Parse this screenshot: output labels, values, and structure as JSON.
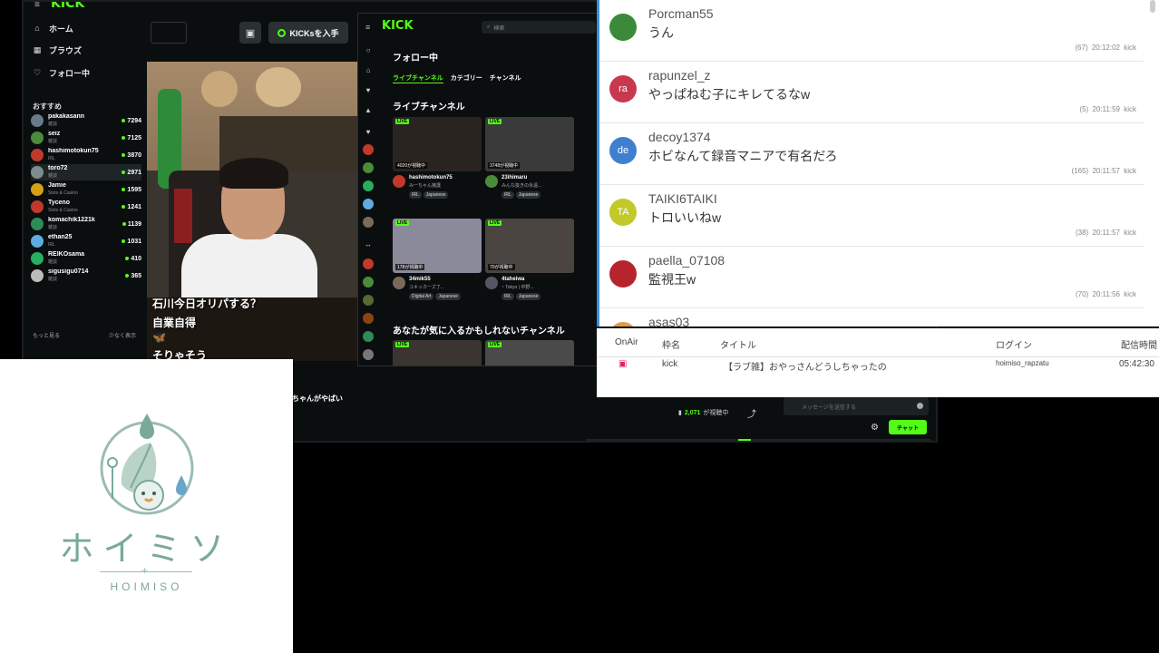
{
  "kick_main": {
    "logo": "KICK",
    "nav": [
      {
        "icon": "home-icon",
        "glyph": "⌂",
        "label": "ホーム"
      },
      {
        "icon": "browse-icon",
        "glyph": "▦",
        "label": "ブラウズ"
      },
      {
        "icon": "heart-icon",
        "glyph": "♡",
        "label": "フォロー中"
      }
    ],
    "recommended_heading": "おすすめ",
    "channels": [
      {
        "name": "pakakasann",
        "category": "雑談",
        "viewers": "7294",
        "color": "#6b7a8a"
      },
      {
        "name": "seiz",
        "category": "雑談",
        "viewers": "7125",
        "color": "#4b8b3b"
      },
      {
        "name": "hashimotokun75",
        "category": "IRL",
        "viewers": "3870",
        "color": "#c0392b"
      },
      {
        "name": "toro72",
        "category": "雑談",
        "viewers": "2971",
        "color": "#7f8c8d"
      },
      {
        "name": "Jamie",
        "category": "Slots & Casino",
        "viewers": "1595",
        "color": "#d4a017"
      },
      {
        "name": "Tyceno",
        "category": "Slots & Casino",
        "viewers": "1241",
        "color": "#c0392b"
      },
      {
        "name": "komachik1221k",
        "category": "雑談",
        "viewers": "1139",
        "color": "#2e8b57"
      },
      {
        "name": "ethan25",
        "category": "IRL",
        "viewers": "1031",
        "color": "#5dade2"
      },
      {
        "name": "REIKOsama",
        "category": "雑談",
        "viewers": "410",
        "color": "#27ae60"
      },
      {
        "name": "sigusigu0714",
        "category": "雑談",
        "viewers": "365",
        "color": "#bbb"
      }
    ],
    "show_more": "もっと見る",
    "show_less": "少なく表示",
    "kicks_button": "KICKsを入手",
    "overlay_lines": [
      "石川今日オリパする？",
      "自業自得",
      "そりゃそう"
    ],
    "stream_title": "ちゃんがやばい",
    "viewers_count": "2,071",
    "viewers_suffix": "が視聴中",
    "chat_placeholder": "メッセージを送信する",
    "chat_button": "チャット",
    "accent": "#53fc18"
  },
  "kick_follow": {
    "logo": "KICK",
    "search_placeholder": "検索",
    "heading": "フォロー中",
    "tabs": [
      "ライブチャンネル",
      "カテゴリー",
      "チャンネル"
    ],
    "live_heading": "ライブチャンネル",
    "suggest_heading": "あなたが気に入るかもしれないチャンネル",
    "live_badge": "LIVE",
    "cards": [
      {
        "viewers": "4020が視聴中",
        "name": "hashimotokun75",
        "title": "みーちゃん擁護",
        "tags": [
          "IRL",
          "Japanese"
        ],
        "bg": "#2a2420",
        "av": "#c0392b"
      },
      {
        "viewers": "3748が視聴中",
        "name": "23ihimaru",
        "title": "みんな抜きの永遠...",
        "tags": [
          "IRL",
          "Japanese"
        ],
        "bg": "#3a3a3a",
        "av": "#4b8b3b"
      },
      {
        "viewers": "178が視聴中",
        "name": "34mik55",
        "title": "ユキッカーズ了...",
        "tags": [
          "Digital Art",
          "Japanese"
        ],
        "bg": "#8b8a9a",
        "av": "#7a6a5a"
      },
      {
        "viewers": "70が視聴中",
        "name": "4taheiwa",
        "title": "~ Tokyo | 中野...",
        "tags": [
          "IRL",
          "Japanese"
        ],
        "bg": "#4a4540",
        "av": "#556"
      }
    ]
  },
  "chat": {
    "messages": [
      {
        "user": "Porcman55",
        "initials": "",
        "text": "うん",
        "count": "(67)",
        "time": "20:12:02",
        "src": "kick",
        "color": "#3a8a3a"
      },
      {
        "user": "rapunzel_z",
        "initials": "ra",
        "text": "やっぱねむ子にキレてるなw",
        "count": "(5)",
        "time": "20:11:59",
        "src": "kick",
        "color": "#c8384f"
      },
      {
        "user": "decoy1374",
        "initials": "de",
        "text": "ホビなんて録音マニアで有名だろ",
        "count": "(165)",
        "time": "20:11:57",
        "src": "kick",
        "color": "#3f7fd0"
      },
      {
        "user": "TAIKI6TAIKI",
        "initials": "TA",
        "text": "トロいいねw",
        "count": "(38)",
        "time": "20:11:57",
        "src": "kick",
        "color": "#c2c928"
      },
      {
        "user": "paella_07108",
        "initials": "",
        "text": "監視王w",
        "count": "(70)",
        "time": "20:11:56",
        "src": "kick",
        "color": "#b8242c"
      },
      {
        "user": "asas03",
        "initials": "",
        "text": "",
        "count": "",
        "time": "",
        "src": "",
        "color": "#e39a4a"
      }
    ]
  },
  "info": {
    "headers": [
      "OnAir",
      "枠名",
      "タイトル",
      "ログイン",
      "配信時間"
    ],
    "row": {
      "onair": "▣",
      "frame": "kick",
      "title": "【ラブ雑】おやっさんどうしちゃったの",
      "login": "hoimiso_rapzatu",
      "duration": "05:42:30"
    }
  },
  "logo": {
    "jp": "ホイミソ",
    "en": "HOIMISO",
    "color": "#7aa99c"
  }
}
